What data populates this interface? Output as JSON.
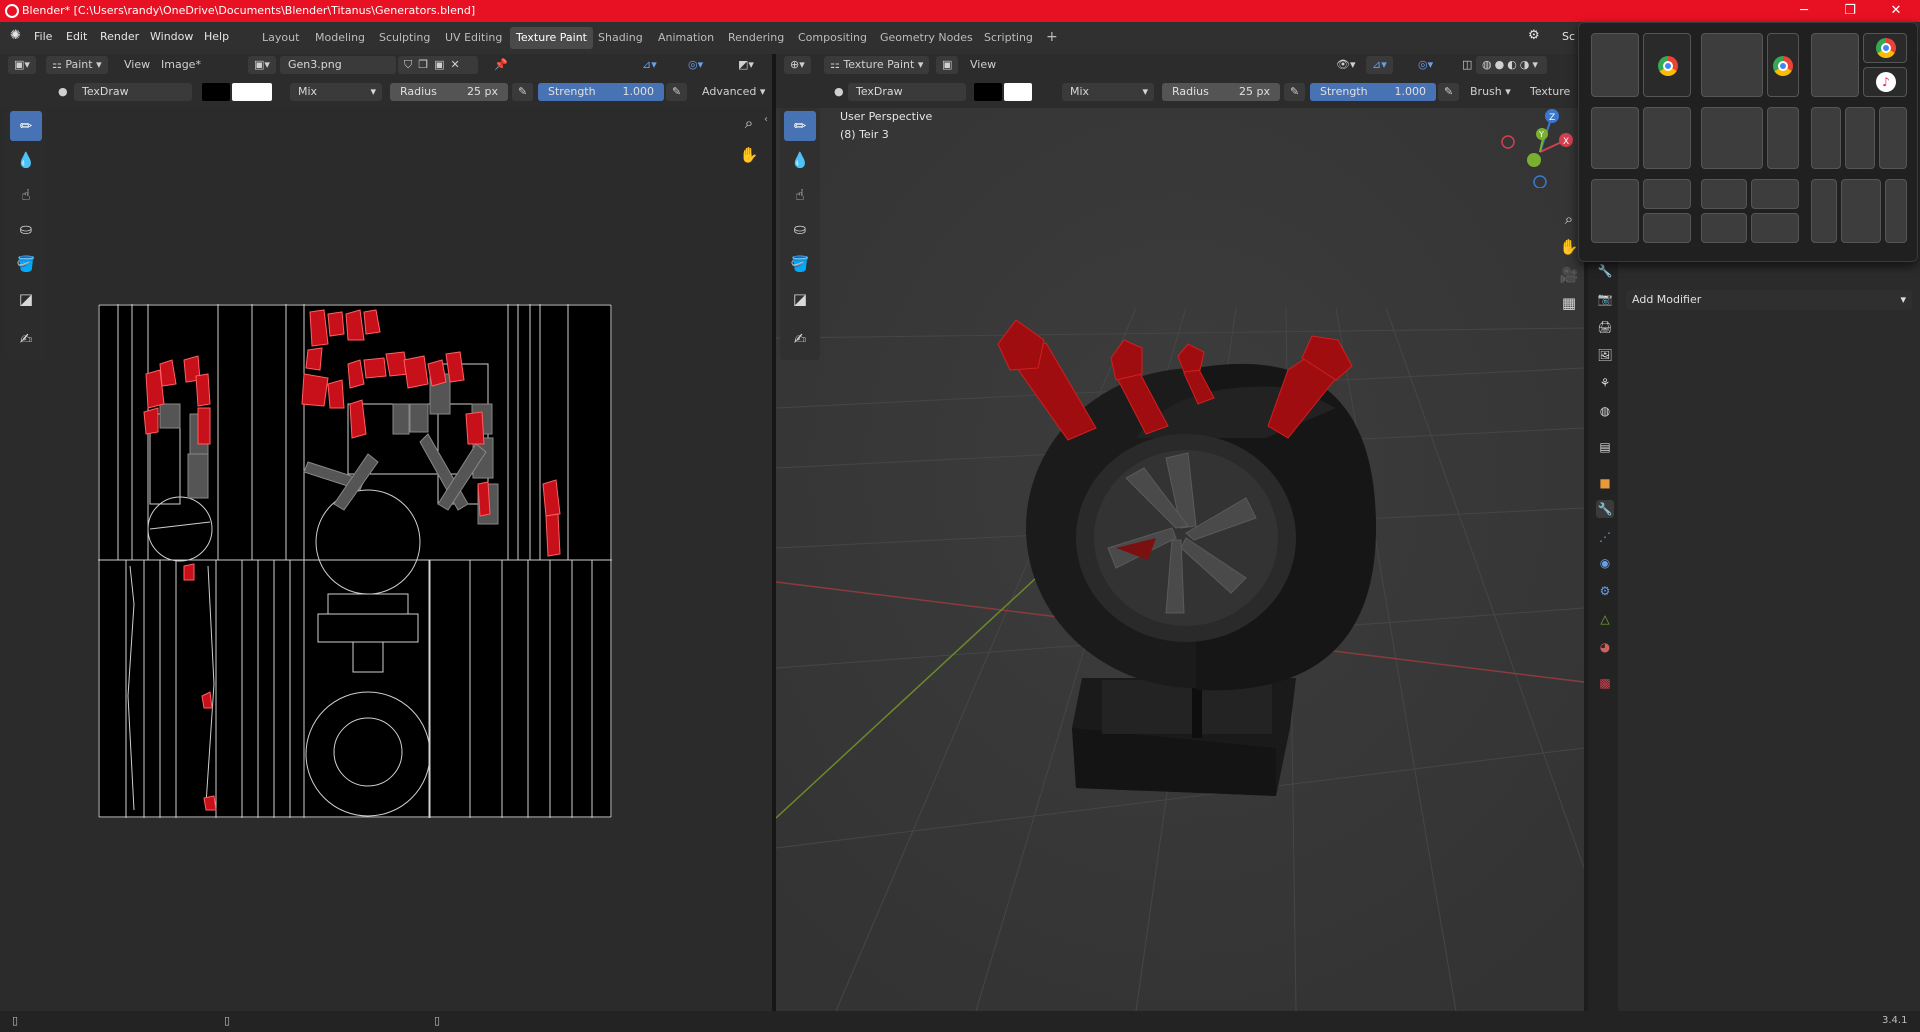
{
  "titlebar": {
    "title": "Blender* [C:\\Users\\randy\\OneDrive\\Documents\\Blender\\Titanus\\Generators.blend]",
    "minimize": "─",
    "restore": "❐",
    "close": "✕"
  },
  "menu": [
    "File",
    "Edit",
    "Render",
    "Window",
    "Help"
  ],
  "workspaces": [
    "Layout",
    "Modeling",
    "Sculpting",
    "UV Editing",
    "Texture Paint",
    "Shading",
    "Animation",
    "Rendering",
    "Compositing",
    "Geometry Nodes",
    "Scripting"
  ],
  "active_workspace": "Texture Paint",
  "scene_label": "Sc",
  "uv_header": {
    "mode": "Paint",
    "view": "View",
    "image_menu": "Image*",
    "image_name": "Gen3.png"
  },
  "uv_tool": {
    "brush": "TexDraw",
    "blend": "Mix",
    "radius_label": "Radius",
    "radius_value": "25 px",
    "strength_label": "Strength",
    "strength_value": "1.000",
    "advanced": "Advanced"
  },
  "vp_header": {
    "mode": "Texture Paint",
    "view": "View"
  },
  "vp_tool": {
    "brush": "TexDraw",
    "blend": "Mix",
    "radius_label": "Radius",
    "radius_value": "25 px",
    "strength_label": "Strength",
    "strength_value": "1.000",
    "brush_menu": "Brush",
    "texture_menu": "Texture"
  },
  "viewport": {
    "perspective": "User Perspective",
    "object": "(8) Teir 3"
  },
  "gizmo": {
    "z": "Z",
    "y": "Y",
    "x": "X"
  },
  "props": {
    "add_modifier": "Add Modifier",
    "object_name": "Teir 3"
  },
  "status": {
    "version": "3.4.1"
  },
  "colors": {
    "accent": "#4772b3",
    "titlebar": "#e81123",
    "paint": "#c8101a"
  }
}
